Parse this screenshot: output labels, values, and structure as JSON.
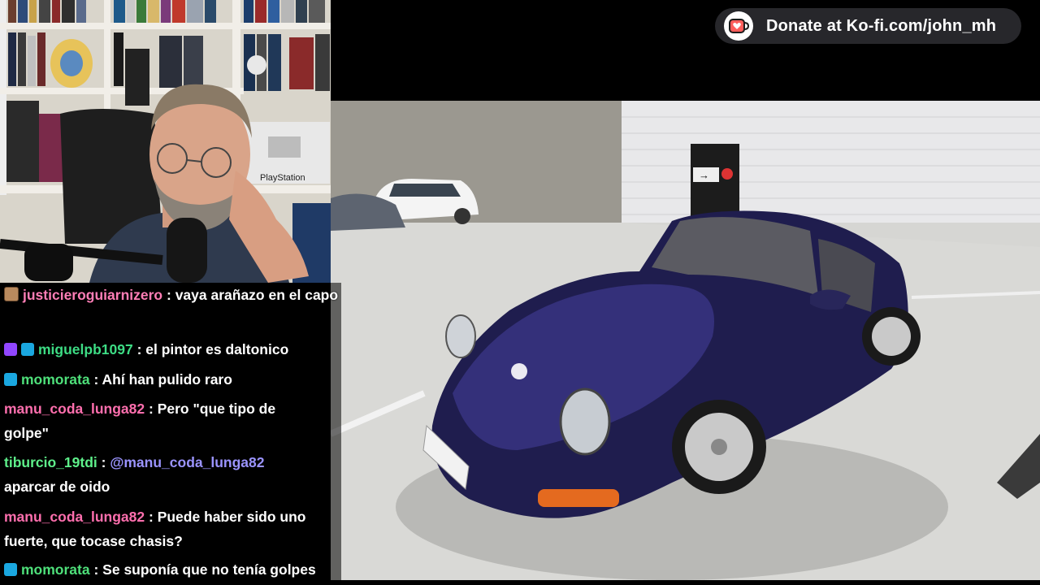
{
  "kofi": {
    "text": "Donate at Ko-fi.com/john_mh",
    "icon": "kofi-heart-cup-icon",
    "accent": "#ff5e5b"
  },
  "chat": {
    "messages": [
      {
        "badges": [
          "avatar-badge"
        ],
        "user": "justicieroguiarnizero",
        "color": "#ff7eb6",
        "text": "vaya arañazo en el capo"
      },
      {
        "badges": [
          "prime-badge",
          "subscriber-crown-badge"
        ],
        "user": "miguelpb1097",
        "color": "#3ddc84",
        "text": "el pintor es daltonico"
      },
      {
        "badges": [
          "subscriber-crown-badge"
        ],
        "user": "momorata",
        "color": "#4ee07a",
        "text": "Ahí han pulido raro"
      },
      {
        "badges": [],
        "user": "manu_coda_lunga82",
        "color": "#ff6fae",
        "text": "Pero \"que tipo de golpe\""
      },
      {
        "badges": [],
        "user": "tiburcio_19tdi",
        "color": "#5ef08a",
        "mention": "@manu_coda_lunga82",
        "text": "aparcar de oido"
      },
      {
        "badges": [],
        "user": "manu_coda_lunga82",
        "color": "#ff6fae",
        "text": "Puede haber sido uno fuerte, que tocase chasis?"
      },
      {
        "badges": [
          "subscriber-crown-badge"
        ],
        "user": "momorata",
        "color": "#4ee07a",
        "text": "Se suponía que no tenía golpes"
      }
    ]
  },
  "webcam": {
    "playstation_label": "PlayStation"
  },
  "video": {
    "sign_text": "→"
  }
}
